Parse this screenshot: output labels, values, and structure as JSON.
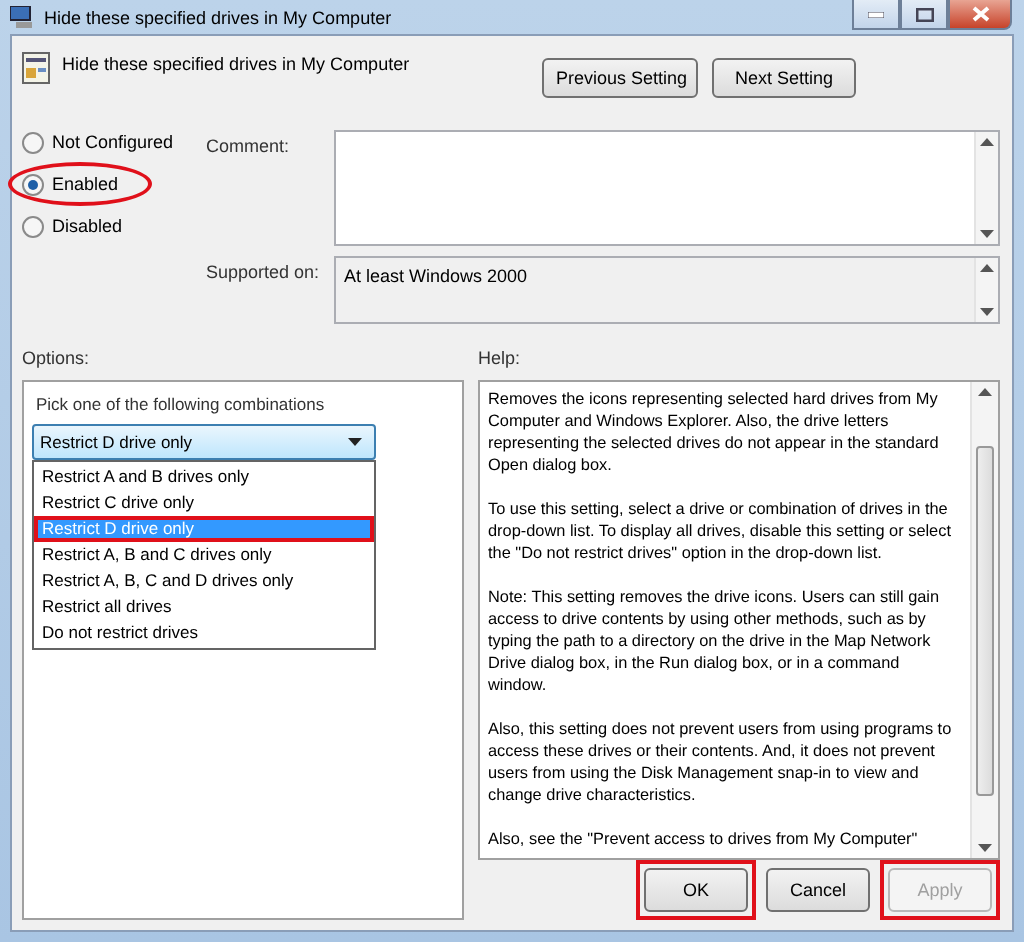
{
  "window": {
    "title": "Hide these specified drives in My Computer"
  },
  "header": {
    "title": "Hide these specified drives in My Computer",
    "buttons": [
      {
        "label": "Previous Setting"
      },
      {
        "label": "Next Setting"
      }
    ]
  },
  "states": [
    {
      "label": "Not Configured",
      "selected": false,
      "highlighted": false
    },
    {
      "label": "Enabled",
      "selected": true,
      "highlighted": true
    },
    {
      "label": "Disabled",
      "selected": false,
      "highlighted": false
    }
  ],
  "comment": {
    "label": "Comment:"
  },
  "supported": {
    "label": "Supported on:",
    "value": "At least Windows 2000"
  },
  "options": {
    "label": "Options:",
    "prompt": "Pick one of the following combinations",
    "dropdown": {
      "value": "Restrict D drive only",
      "expanded": true
    },
    "items": [
      {
        "label": "Restrict A and B drives only",
        "selected": false,
        "highlighted": false
      },
      {
        "label": "Restrict C drive only",
        "selected": false,
        "highlighted": false
      },
      {
        "label": "Restrict D drive only",
        "selected": true,
        "highlighted": true
      },
      {
        "label": "Restrict A, B and C drives only",
        "selected": false,
        "highlighted": false
      },
      {
        "label": "Restrict A, B, C and D drives only",
        "selected": false,
        "highlighted": false
      },
      {
        "label": "Restrict all drives",
        "selected": false,
        "highlighted": false
      },
      {
        "label": "Do not restrict drives",
        "selected": false,
        "highlighted": false
      }
    ]
  },
  "help": {
    "label": "Help:",
    "paragraphs": [
      "Removes the icons representing selected hard drives from My Computer and Windows Explorer. Also, the drive letters representing the selected drives do not appear in the standard Open dialog box.",
      "To use this setting, select a drive or combination of drives in the drop-down list. To display all drives, disable this setting or select the \"Do not restrict drives\" option in the drop-down list.",
      "Note: This setting removes the drive icons. Users can still gain access to drive contents by using other methods, such as by typing the path to a directory on the drive in the Map Network Drive dialog box, in the Run dialog box, or in a command window.",
      "Also, this setting does not prevent users from using programs to access these drives or their contents. And, it does not prevent users from using the Disk Management snap-in to view and change drive characteristics.",
      "Also, see the \"Prevent access to drives from My Computer\""
    ]
  },
  "buttons": [
    {
      "label": "OK",
      "disabled": false,
      "highlighted": true
    },
    {
      "label": "Cancel",
      "disabled": false,
      "highlighted": false
    },
    {
      "label": "Apply",
      "disabled": true,
      "highlighted": true
    }
  ]
}
